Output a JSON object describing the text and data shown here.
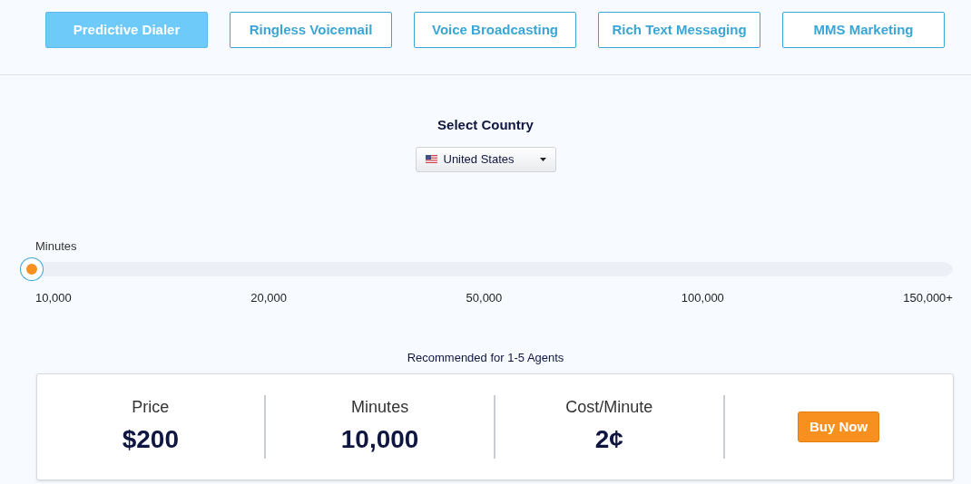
{
  "tabs": [
    {
      "label": "Predictive Dialer",
      "selected": true
    },
    {
      "label": "Ringless Voicemail",
      "selected": false
    },
    {
      "label": "Voice Broadcasting",
      "selected": false
    },
    {
      "label": "Rich Text Messaging",
      "selected": false
    },
    {
      "label": "MMS Marketing",
      "selected": false
    }
  ],
  "country": {
    "heading": "Select Country",
    "value": "United States"
  },
  "slider": {
    "label": "Minutes",
    "level": 0,
    "ticks": [
      "10,000",
      "20,000",
      "50,000",
      "100,000",
      "150,000+"
    ]
  },
  "plan": {
    "note": "Recommended for 1-5 Agents",
    "stats": [
      {
        "label": "Price",
        "value": "$200"
      },
      {
        "label": "Minutes",
        "value": "10,000"
      },
      {
        "label": "Cost/Minute",
        "value": "2¢"
      }
    ],
    "button": "Buy Now"
  }
}
